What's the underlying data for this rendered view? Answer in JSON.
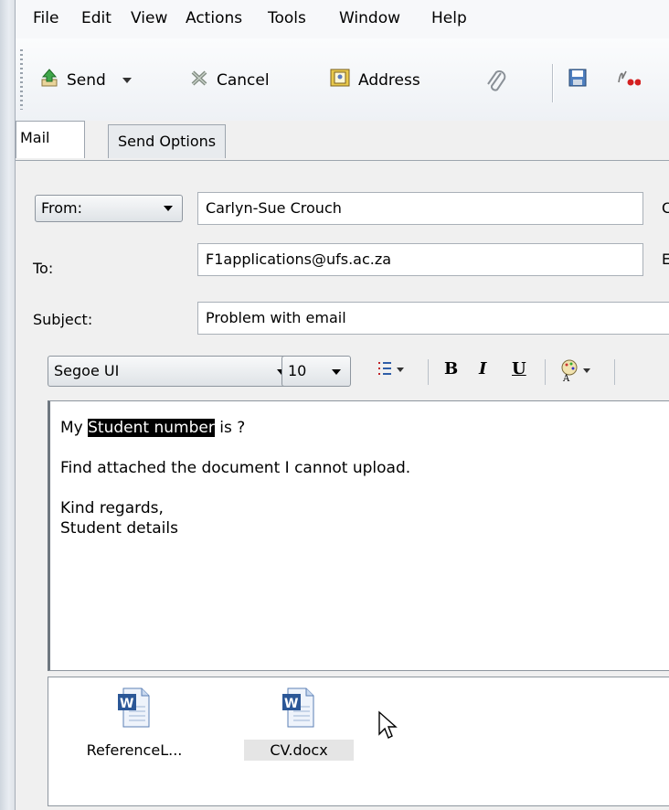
{
  "menu": [
    "File",
    "Edit",
    "View",
    "Actions",
    "Tools",
    "Window",
    "Help"
  ],
  "toolbar": {
    "send": "Send",
    "cancel": "Cancel",
    "address": "Address"
  },
  "tabs": {
    "mail": "Mail",
    "send_options": "Send Options"
  },
  "header": {
    "from_label": "From:",
    "from_value": "Carlyn-Sue Crouch",
    "to_label": "To:",
    "to_value": "F1applications@ufs.ac.za",
    "subject_label": "Subject:",
    "subject_value": "Problem with email",
    "right_label_1": "C",
    "right_label_2": "E"
  },
  "format": {
    "font": "Segoe UI",
    "size": "10",
    "bold": "B",
    "italic": "I",
    "underline": "U"
  },
  "body": {
    "line1_pre": "My ",
    "line1_hl": "Student number",
    "line1_post": " is ?",
    "line2": "Find attached the document I cannot upload.",
    "line3": "Kind regards,",
    "line4": "Student details"
  },
  "attachments": [
    {
      "name": "ReferenceL..."
    },
    {
      "name": "CV.docx"
    }
  ]
}
